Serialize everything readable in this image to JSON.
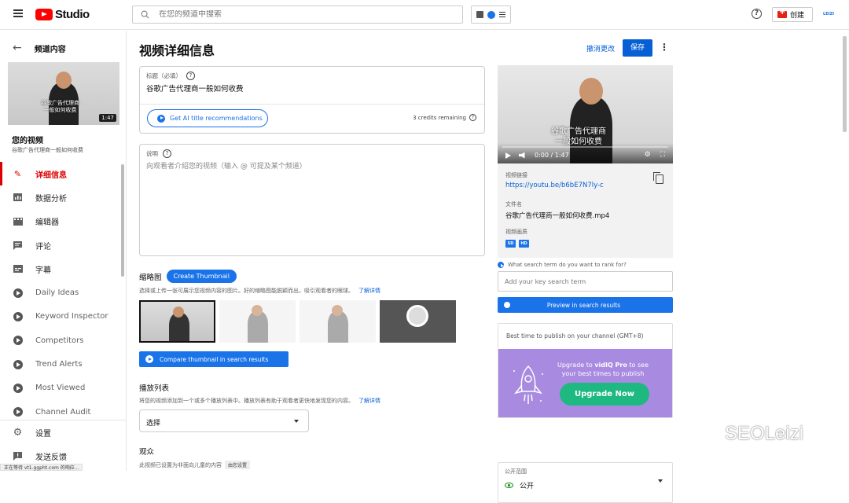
{
  "header": {
    "logo_text": "Studio",
    "search_placeholder": "在您的频道中搜索",
    "create_label": "创建",
    "avatar_text": "LEIZI"
  },
  "sidebar": {
    "back_label": "频道内容",
    "thumb_caption": "谷歌广告代理商\n一般如何收费",
    "thumb_duration": "1:47",
    "your_video_label": "您的视频",
    "video_title": "谷歌广告代理商一般如何收费",
    "items": [
      {
        "label": "详细信息",
        "icon": "pencil-icon"
      },
      {
        "label": "数据分析",
        "icon": "analytics-icon"
      },
      {
        "label": "编辑器",
        "icon": "editor-icon"
      },
      {
        "label": "评论",
        "icon": "comments-icon"
      },
      {
        "label": "字幕",
        "icon": "subtitles-icon"
      },
      {
        "label": "Daily Ideas",
        "icon": "vidiq-icon"
      },
      {
        "label": "Keyword Inspector",
        "icon": "vidiq-icon"
      },
      {
        "label": "Competitors",
        "icon": "vidiq-icon"
      },
      {
        "label": "Trend Alerts",
        "icon": "vidiq-icon"
      },
      {
        "label": "Most Viewed",
        "icon": "vidiq-icon"
      },
      {
        "label": "Channel Audit",
        "icon": "vidiq-icon"
      }
    ],
    "settings_label": "设置",
    "feedback_label": "发送反馈"
  },
  "status_bar_text": "正在等待 vt1.ggpht.com 的响应...",
  "main": {
    "page_title": "视频详细信息",
    "undo_label": "撤消更改",
    "save_label": "保存",
    "title_field": {
      "label": "标题（必填）",
      "value": "谷歌广告代理商一般如何收费",
      "ai_button": "Get AI title recommendations",
      "credits": "3 credits remaining"
    },
    "description_field": {
      "label": "说明",
      "placeholder": "向观看者介绍您的视频（输入 @ 可提及某个频道）"
    },
    "thumbnail": {
      "heading": "缩略图",
      "create_button": "Create Thumbnail",
      "description": "选择或上传一张可展示您视频内容的图片。好的缩略图能脱颖而出，吸引观看者的眼球。",
      "learn_more": "了解详情",
      "compare_button": "Compare thumbnail in search results"
    },
    "playlist": {
      "heading": "播放列表",
      "description": "将您的视频添加到一个或多个播放列表中。播放列表有助于观看者更快地发现您的内容。",
      "learn_more": "了解详情",
      "select_value": "选择"
    },
    "audience": {
      "heading": "观众",
      "sub": "此视频已设置为非面向儿童的内容",
      "badge": "由您设置"
    }
  },
  "right": {
    "player_caption": "谷歌广告代理商\n一般如何收费",
    "time": "0:00 / 1:47",
    "video_link_label": "视频链接",
    "video_link": "https://youtu.be/b6bE7N7ly-c",
    "file_name_label": "文件名",
    "file_name": "谷歌广告代理商一般如何收费.mp4",
    "quality_label": "视频画质",
    "quality_badges": [
      "SD",
      "HD"
    ],
    "rank_question": "What search term do you want to rank for?",
    "rank_placeholder": "Add your key search term",
    "preview_button": "Preview in search results",
    "best_time_title": "Best time to publish on your channel (GMT+8)",
    "upgrade_text_1": "Upgrade to ",
    "upgrade_brand": "vidIQ Pro",
    "upgrade_text_2": " to see your best times to publish",
    "upgrade_button": "Upgrade Now",
    "visibility_label": "公开范围",
    "visibility_value": "公开"
  },
  "watermark": "SEOLeizi"
}
